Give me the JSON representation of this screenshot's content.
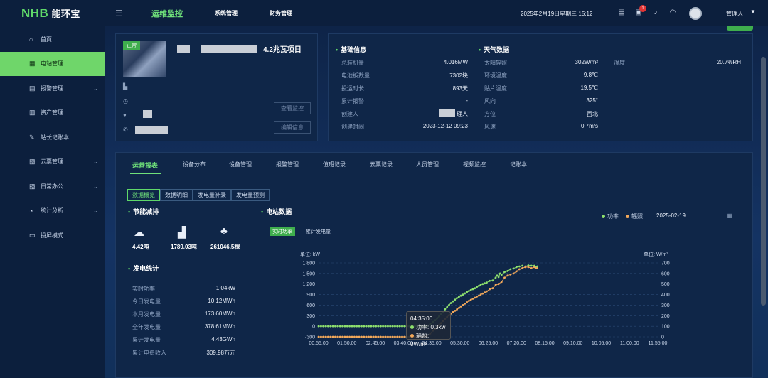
{
  "app": {
    "logo_mark": "NHB",
    "logo_name": "能环宝"
  },
  "topnav": [
    "运维监控",
    "系统管理",
    "财务管理"
  ],
  "header": {
    "datetime": "2025年2月19日星期三 15:12",
    "badge_count": "1",
    "user": "管理人"
  },
  "sidebar": {
    "items": [
      {
        "label": "首页",
        "icon": "home-icon"
      },
      {
        "label": "电站管理",
        "icon": "station-icon"
      },
      {
        "label": "报警管理",
        "icon": "alarm-icon"
      },
      {
        "label": "资产管理",
        "icon": "asset-icon"
      },
      {
        "label": "站长记账本",
        "icon": "ledger-icon"
      },
      {
        "label": "云票管理",
        "icon": "ticket-icon"
      },
      {
        "label": "日常办公",
        "icon": "calendar-icon"
      },
      {
        "label": "统计分析",
        "icon": "stats-icon"
      },
      {
        "label": "投屏模式",
        "icon": "monitor-icon"
      }
    ]
  },
  "project": {
    "badge": "正常",
    "title": "4.2兆瓦项目",
    "contact_suffix": "",
    "view_monitor": "查看监控",
    "edit_info": "编辑信息"
  },
  "basic_info": {
    "title": "基础信息",
    "rows": [
      {
        "label": "总装机量",
        "value": "4.016MW"
      },
      {
        "label": "电池板数量",
        "value": "7302块"
      },
      {
        "label": "投运时长",
        "value": "893天"
      },
      {
        "label": "累计报警",
        "value": "-"
      },
      {
        "label": "创建人",
        "value": "理人"
      },
      {
        "label": "创建时间",
        "value": "2023-12-12 09:23"
      }
    ]
  },
  "weather": {
    "title": "天气数据",
    "rows": [
      {
        "label": "太阳辐照",
        "value": "302W/m²"
      },
      {
        "label": "环境温度",
        "value": "9.8℃"
      },
      {
        "label": "贴片温度",
        "value": "19.5℃"
      },
      {
        "label": "风向",
        "value": "325°"
      },
      {
        "label": "方位",
        "value": "西北"
      },
      {
        "label": "风速",
        "value": "0.7m/s"
      }
    ],
    "humidity_label": "湿度",
    "humidity_value": "20.7%RH"
  },
  "tabs": [
    "运营报表",
    "设备分布",
    "设备管理",
    "报警管理",
    "值班记录",
    "云票记录",
    "人员管理",
    "视频监控",
    "记账本"
  ],
  "subtabs": [
    "数据概览",
    "数据明细",
    "发电量补录",
    "发电量预测"
  ],
  "savings": {
    "title": "节能减排",
    "items": [
      {
        "icon": "co2-cloud-icon",
        "value": "4.42吨"
      },
      {
        "icon": "factory-icon",
        "value": "1789.03吨"
      },
      {
        "icon": "tree-icon",
        "value": "261046.5棵"
      }
    ]
  },
  "generation": {
    "title": "发电统计",
    "rows": [
      {
        "label": "实时功率",
        "value": "1.04kW"
      },
      {
        "label": "今日发电量",
        "value": "10.12MWh"
      },
      {
        "label": "本月发电量",
        "value": "173.60MWh"
      },
      {
        "label": "全年发电量",
        "value": "378.61MWh"
      },
      {
        "label": "累计发电量",
        "value": "4.43GWh"
      },
      {
        "label": "累计电费收入",
        "value": "309.98万元"
      }
    ]
  },
  "station": {
    "title": "电站数据",
    "legend": [
      "功率",
      "辐照"
    ],
    "date": "2025-02-19",
    "realtime_tag": "实时功率",
    "cumulative_tag": "累计发电量"
  },
  "tooltip": {
    "time": "04:35:00",
    "power": "功率: 0.3kw",
    "irr": "辐照: 0W/m²"
  },
  "chart_data": {
    "type": "line",
    "left_unit": "单位:  kW",
    "right_unit": "单位:  W/m²",
    "x_ticks": [
      "00:55:00",
      "01:50:00",
      "02:45:00",
      "03:40:00",
      "04:35:00",
      "05:30:00",
      "06:25:00",
      "07:20:00",
      "08:15:00",
      "09:10:00",
      "10:05:00",
      "11:00:00",
      "11:55:00"
    ],
    "y_left_ticks": [
      "-300",
      "0",
      "300",
      "600",
      "900",
      "1,200",
      "1,500",
      "1,800"
    ],
    "y_right_ticks": [
      "0",
      "100",
      "200",
      "300",
      "400",
      "500",
      "600",
      "700"
    ],
    "ylim_left": [
      -300,
      1800
    ],
    "ylim_right": [
      0,
      700
    ],
    "x_minutes": [
      55,
      1195
    ],
    "series": [
      {
        "name": "功率",
        "color": "#8ee06d",
        "axis": "left",
        "points": [
          [
            55,
            0
          ],
          [
            400,
            0
          ],
          [
            410,
            0
          ],
          [
            415,
            0
          ],
          [
            420,
            10
          ],
          [
            430,
            60
          ],
          [
            440,
            120
          ],
          [
            460,
            280
          ],
          [
            480,
            480
          ],
          [
            500,
            660
          ],
          [
            520,
            800
          ],
          [
            540,
            900
          ],
          [
            560,
            1000
          ],
          [
            580,
            1080
          ],
          [
            600,
            1180
          ],
          [
            620,
            1240
          ],
          [
            630,
            1290
          ],
          [
            640,
            1300
          ],
          [
            650,
            1380
          ],
          [
            655,
            1440
          ],
          [
            660,
            1400
          ],
          [
            665,
            1500
          ],
          [
            670,
            1460
          ],
          [
            680,
            1540
          ],
          [
            690,
            1570
          ],
          [
            700,
            1620
          ],
          [
            710,
            1640
          ],
          [
            720,
            1680
          ],
          [
            730,
            1700
          ],
          [
            740,
            1720
          ],
          [
            750,
            1700
          ],
          [
            760,
            1730
          ],
          [
            770,
            1720
          ],
          [
            780,
            1720
          ],
          [
            785,
            1690
          ],
          [
            790,
            1700
          ]
        ]
      },
      {
        "name": "辐照",
        "color": "#f2a85a",
        "axis": "right",
        "points": [
          [
            55,
            0
          ],
          [
            400,
            0
          ],
          [
            410,
            0
          ],
          [
            415,
            5
          ],
          [
            420,
            10
          ],
          [
            430,
            30
          ],
          [
            440,
            60
          ],
          [
            460,
            110
          ],
          [
            480,
            170
          ],
          [
            500,
            220
          ],
          [
            520,
            260
          ],
          [
            540,
            300
          ],
          [
            560,
            340
          ],
          [
            580,
            370
          ],
          [
            600,
            400
          ],
          [
            620,
            430
          ],
          [
            630,
            450
          ],
          [
            640,
            460
          ],
          [
            650,
            490
          ],
          [
            660,
            500
          ],
          [
            670,
            520
          ],
          [
            680,
            560
          ],
          [
            690,
            580
          ],
          [
            700,
            590
          ],
          [
            710,
            600
          ],
          [
            720,
            620
          ],
          [
            730,
            640
          ],
          [
            740,
            650
          ],
          [
            750,
            660
          ],
          [
            760,
            660
          ],
          [
            770,
            650
          ],
          [
            780,
            660
          ],
          [
            785,
            650
          ],
          [
            790,
            650
          ]
        ]
      }
    ]
  }
}
